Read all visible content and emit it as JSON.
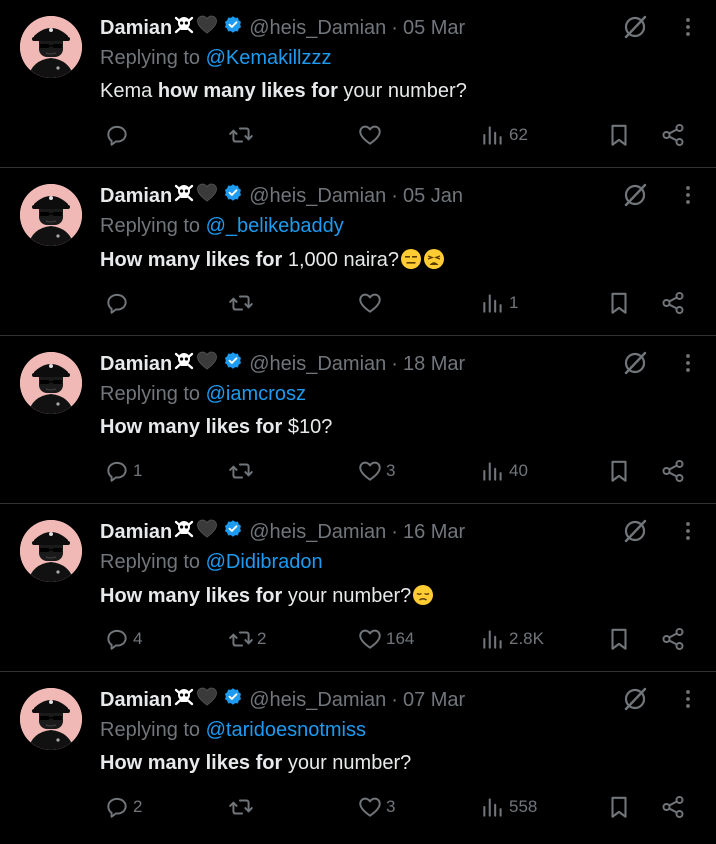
{
  "author": {
    "name": "Damian",
    "handle": "@heis_Damian",
    "name_emojis": [
      "skull-crossbones",
      "black-heart"
    ],
    "verified_color": "#1d9bf0"
  },
  "colors": {
    "background": "#000000",
    "text": "#e7e9ea",
    "muted": "#71767b",
    "link": "#1d9bf0",
    "divider": "#2f3336"
  },
  "reply_prefix": "Replying to",
  "tweets": [
    {
      "date": "05 Mar",
      "reply_to": "@Kemakillzzz",
      "text_parts": [
        {
          "t": "Kema ",
          "bold": false
        },
        {
          "t": "how many likes for",
          "bold": true
        },
        {
          "t": " your number?",
          "bold": false
        }
      ],
      "emojis": [],
      "replies": "",
      "retweets": "",
      "likes": "",
      "views": "62"
    },
    {
      "date": "05 Jan",
      "reply_to": "@_belikebaddy",
      "text_parts": [
        {
          "t": "How many likes for",
          "bold": true
        },
        {
          "t": " 1,000 naira?",
          "bold": false
        }
      ],
      "emojis": [
        "expressionless-face",
        "weary-face"
      ],
      "replies": "",
      "retweets": "",
      "likes": "",
      "views": "1"
    },
    {
      "date": "18 Mar",
      "reply_to": "@iamcrosz",
      "text_parts": [
        {
          "t": "How many likes for",
          "bold": true
        },
        {
          "t": " $10?",
          "bold": false
        }
      ],
      "emojis": [],
      "replies": "1",
      "retweets": "",
      "likes": "3",
      "views": "40"
    },
    {
      "date": "16 Mar",
      "reply_to": "@Didibradon",
      "text_parts": [
        {
          "t": "How many likes for",
          "bold": true
        },
        {
          "t": " your number?",
          "bold": false
        }
      ],
      "emojis": [
        "disappointed-face"
      ],
      "replies": "4",
      "retweets": "2",
      "likes": "164",
      "views": "2.8K"
    },
    {
      "date": "07 Mar",
      "reply_to": "@taridoesnotmiss",
      "text_parts": [
        {
          "t": "How many likes for",
          "bold": true
        },
        {
          "t": " your number?",
          "bold": false
        }
      ],
      "emojis": [],
      "replies": "2",
      "retweets": "",
      "likes": "3",
      "views": "558"
    }
  ]
}
